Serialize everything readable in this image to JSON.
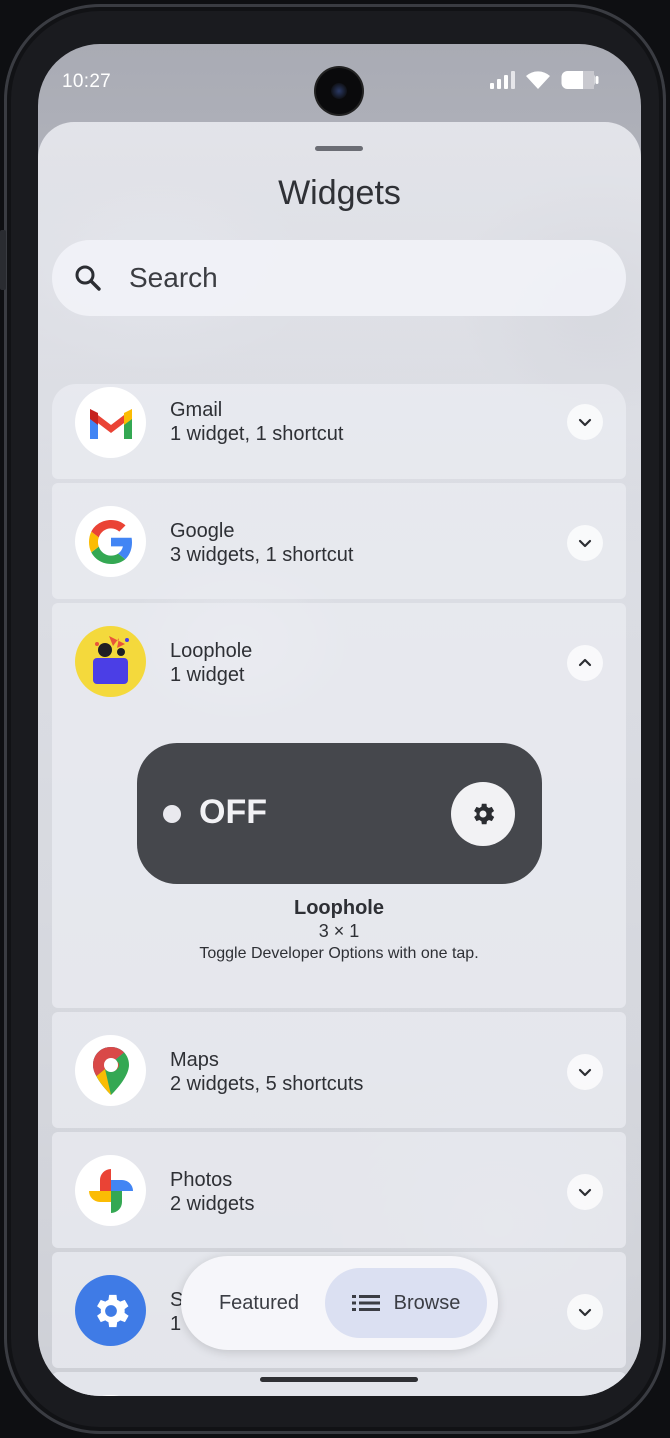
{
  "status_bar": {
    "time": "10:27"
  },
  "sheet": {
    "title": "Widgets"
  },
  "search": {
    "placeholder": "Search"
  },
  "apps": [
    {
      "name": "Gmail",
      "subtitle": "1 widget, 1 shortcut",
      "icon": "gmail-icon",
      "expanded": false
    },
    {
      "name": "Google",
      "subtitle": "3 widgets, 1 shortcut",
      "icon": "google-icon",
      "expanded": false
    },
    {
      "name": "Loophole",
      "subtitle": "1 widget",
      "icon": "loophole-icon",
      "expanded": true
    },
    {
      "name": "Maps",
      "subtitle": "2 widgets, 5 shortcuts",
      "icon": "maps-icon",
      "expanded": false
    },
    {
      "name": "Photos",
      "subtitle": "2 widgets",
      "icon": "photos-icon",
      "expanded": false
    },
    {
      "name": "Settings",
      "subtitle": "1",
      "icon": "settings-icon",
      "expanded": false
    }
  ],
  "widget": {
    "state_label": "OFF",
    "name": "Loophole",
    "size": "3 × 1",
    "description": "Toggle Developer Options with one tap."
  },
  "bottom_tabs": {
    "featured": "Featured",
    "browse": "Browse",
    "selected": "browse"
  },
  "colors": {
    "accent_tab": "#dbe0f2",
    "widget_bg": "#45474c"
  }
}
